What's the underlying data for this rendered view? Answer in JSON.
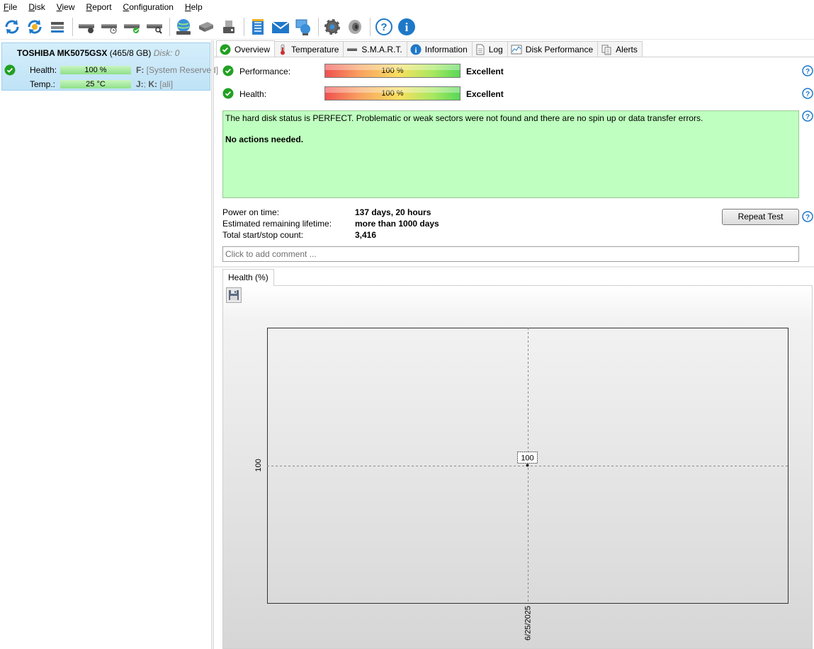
{
  "menu": {
    "items": [
      {
        "first": "F",
        "rest": "ile"
      },
      {
        "first": "D",
        "rest": "isk"
      },
      {
        "first": "V",
        "rest": "iew"
      },
      {
        "first": "R",
        "rest": "eport"
      },
      {
        "first": "C",
        "rest": "onfiguration"
      },
      {
        "first": "H",
        "rest": "elp"
      }
    ]
  },
  "toolbar": {
    "icons": [
      "refresh-icon",
      "refresh-all-icon",
      "disk-list-icon",
      "disk-tool-icon",
      "disk-schedule-icon",
      "disk-check-icon",
      "disk-search-icon",
      "network-icon",
      "benchmark-icon",
      "usb-disk-icon",
      "notepad-icon",
      "email-icon",
      "remote-icon",
      "settings-icon",
      "sound-icon",
      "help-icon",
      "info-icon"
    ]
  },
  "disk": {
    "name": "TOSHIBA MK5075GSX",
    "size": "(465/8 GB)",
    "number": "Disk: 0",
    "health_label": "Health:",
    "health_value": "100 %",
    "temp_label": "Temp.:",
    "temp_value": "25 °C",
    "drive1_letter": "F:",
    "drive1_name": "[System Reserved]",
    "drive2_letter": "J:",
    "drive2_sep": ";",
    "drive2_letter_b": "K:",
    "drive2_name": "[ali]"
  },
  "tabs": [
    {
      "label": "Overview",
      "icon": "check-circle-icon",
      "active": true
    },
    {
      "label": "Temperature",
      "icon": "thermometer-icon"
    },
    {
      "label": "S.M.A.R.T.",
      "icon": "smart-icon"
    },
    {
      "label": "Information",
      "icon": "info-icon"
    },
    {
      "label": "Log",
      "icon": "log-document-icon"
    },
    {
      "label": "Disk Performance",
      "icon": "performance-chart-icon"
    },
    {
      "label": "Alerts",
      "icon": "alerts-icon"
    }
  ],
  "overview": {
    "performance_label": "Performance:",
    "performance_value": "100 %",
    "performance_rating": "Excellent",
    "health_label": "Health:",
    "health_value": "100 %",
    "health_rating": "Excellent",
    "status_text": "The hard disk status is PERFECT. Problematic or weak sectors were not found and there are no spin up or data transfer errors.",
    "action_text": "No actions needed.",
    "power_on_label": "Power on time:",
    "power_on_value": "137 days, 20 hours",
    "lifetime_label": "Estimated remaining lifetime:",
    "lifetime_value": "more than 1000 days",
    "startstop_label": "Total start/stop count:",
    "startstop_value": "3,416",
    "repeat_test_label": "Repeat Test",
    "comment_placeholder": "Click to add comment ..."
  },
  "chart_tab_label": "Health (%)",
  "chart_data": {
    "type": "line",
    "x": [
      "6/25/2025"
    ],
    "series": [
      {
        "values": [
          100
        ]
      }
    ],
    "point_labels": [
      "100"
    ],
    "y_tick_labels": [
      "100"
    ],
    "x_tick_labels": [
      "6/25/2025"
    ],
    "grid": true
  }
}
